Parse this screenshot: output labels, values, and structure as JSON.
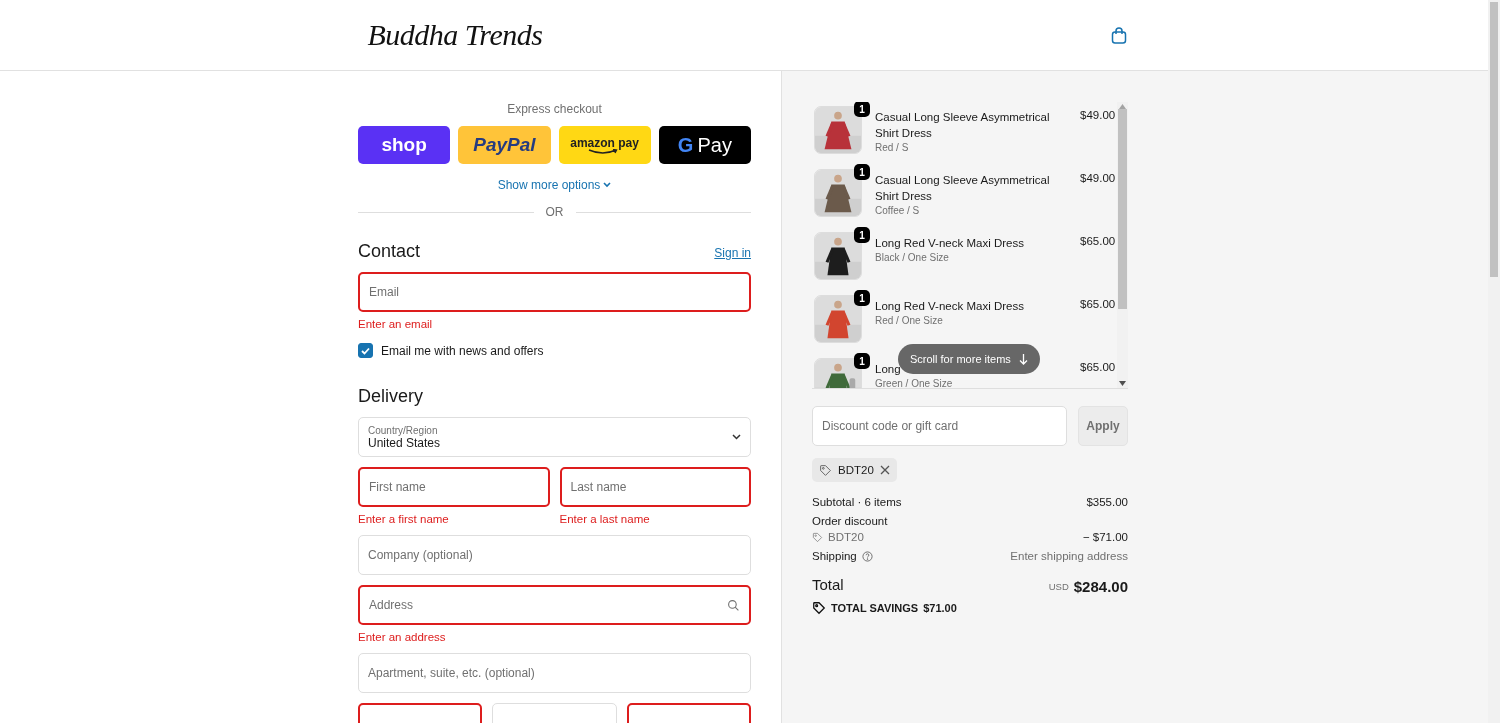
{
  "header": {
    "logo": "Buddha Trends"
  },
  "express": {
    "title": "Express checkout",
    "buttons": [
      {
        "kind": "shop",
        "label": "shop"
      },
      {
        "kind": "paypal",
        "label": "PayPal"
      },
      {
        "kind": "amazon",
        "label": "amazon pay"
      },
      {
        "kind": "gpay",
        "mark": "G",
        "label": "Pay"
      }
    ],
    "more": "Show more options",
    "divider": "OR"
  },
  "contact": {
    "heading": "Contact",
    "sign_in": "Sign in",
    "email": {
      "placeholder": "Email",
      "invalid": true,
      "error": "Enter an email"
    },
    "newsletter": {
      "label": "Email me with news and offers",
      "checked": true
    }
  },
  "delivery": {
    "heading": "Delivery",
    "country": {
      "label": "Country/Region",
      "value": "United States"
    },
    "rows": [
      [
        {
          "kind": "text",
          "placeholder": "First name",
          "invalid": true,
          "error": "Enter a first name"
        },
        {
          "kind": "text",
          "placeholder": "Last name",
          "invalid": true,
          "error": "Enter a last name"
        }
      ],
      [
        {
          "kind": "text",
          "placeholder": "Company (optional)",
          "invalid": false
        }
      ],
      [
        {
          "kind": "search",
          "placeholder": "Address",
          "invalid": true,
          "error": "Enter an address"
        }
      ],
      [
        {
          "kind": "text",
          "placeholder": "Apartment, suite, etc. (optional)",
          "invalid": false
        }
      ],
      [
        {
          "kind": "text",
          "invalid": true
        },
        {
          "kind": "text",
          "invalid": false
        },
        {
          "kind": "text",
          "invalid": true
        }
      ]
    ]
  },
  "cart": {
    "items": [
      {
        "quantity": "1",
        "title": "Casual Long Sleeve Asymmetrical Shirt Dress",
        "variant": "Red / S",
        "price": "$49.00"
      },
      {
        "quantity": "1",
        "title": "Casual Long Sleeve Asymmetrical Shirt Dress",
        "variant": "Coffee / S",
        "price": "$49.00"
      },
      {
        "quantity": "1",
        "title": "Long Red V-neck Maxi Dress",
        "variant": "Black / One Size",
        "price": "$65.00"
      },
      {
        "quantity": "1",
        "title": "Long Red V-neck Maxi Dress",
        "variant": "Red / One Size",
        "price": "$65.00"
      },
      {
        "quantity": "1",
        "title": "Long",
        "variant": "Green / One Size",
        "price": "$65.00"
      }
    ],
    "scroll_hint": "Scroll for more items",
    "discount": {
      "placeholder": "Discount code or gift card",
      "apply": "Apply"
    },
    "applied_code": "BDT20",
    "summary": {
      "subtotal_label": "Subtotal · 6 items",
      "subtotal": "$355.00",
      "discount_label": "Order discount",
      "discount_code": "BDT20",
      "discount_value": "− $71.00",
      "shipping_label": "Shipping",
      "shipping_value": "Enter shipping address",
      "total_label": "Total",
      "currency": "USD",
      "total": "$284.00",
      "savings_label": "TOTAL SAVINGS",
      "savings": "$71.00"
    }
  }
}
